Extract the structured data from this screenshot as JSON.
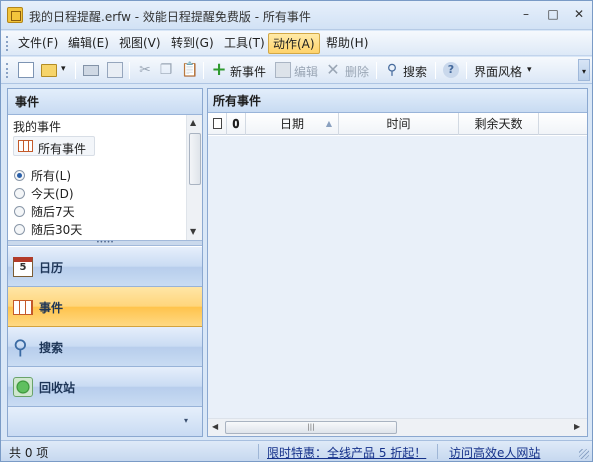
{
  "window": {
    "title": "我的日程提醒.erfw - 效能日程提醒免费版 - 所有事件",
    "controls": {
      "minimize": "–",
      "maximize": "□",
      "close": "✕"
    }
  },
  "menu": {
    "items": [
      "文件(F)",
      "编辑(E)",
      "视图(V)",
      "转到(G)",
      "工具(T)",
      "动作(A)",
      "帮助(H)"
    ],
    "active_index": 5
  },
  "toolbar": {
    "new_event": "新事件",
    "edit": "编辑",
    "delete": "删除",
    "search": "搜索",
    "skin": "界面风格",
    "dropdown_glyph": "▾",
    "overflow_glyph": "▾",
    "icons": [
      "new-doc-icon",
      "open-folder-icon",
      "print-icon",
      "print-preview-icon",
      "cut-icon",
      "copy-icon",
      "paste-icon",
      "add-icon",
      "edit-icon",
      "delete-icon",
      "search-icon",
      "help-icon"
    ]
  },
  "left_pane": {
    "header": "事件",
    "my_events_title": "我的事件",
    "all_events_label": "所有事件",
    "filters": [
      {
        "label": "所有(L)",
        "checked": true
      },
      {
        "label": "今天(D)",
        "checked": false
      },
      {
        "label": "随后7天",
        "checked": false
      },
      {
        "label": "随后30天",
        "checked": false
      }
    ],
    "splitter_glyph": "•••••",
    "nav": [
      {
        "label": "日历",
        "icon": "calendar-icon",
        "icon_text": "5",
        "selected": false
      },
      {
        "label": "事件",
        "icon": "events-grid-icon",
        "selected": true
      },
      {
        "label": "搜索",
        "icon": "magnifier-icon",
        "selected": false
      },
      {
        "label": "回收站",
        "icon": "recycle-bin-icon",
        "selected": false
      }
    ],
    "more_glyph": "▾"
  },
  "right_pane": {
    "header": "所有事件",
    "columns": [
      "",
      "",
      "日期",
      "时间",
      "剩余天数"
    ],
    "column_icons": [
      "document-icon",
      "attachment-icon"
    ],
    "attachment_glyph": "𝟎",
    "sort_glyph": "▲",
    "hscroll_grip": "|||",
    "rows": []
  },
  "status": {
    "count": "共 0 项",
    "promo": "限时特惠：全线产品 5 折起！",
    "site": "访问高效e人网站"
  },
  "colors": {
    "accent": "#ffd36b",
    "panel_header": "#c8dbf2",
    "link": "#15318a"
  }
}
